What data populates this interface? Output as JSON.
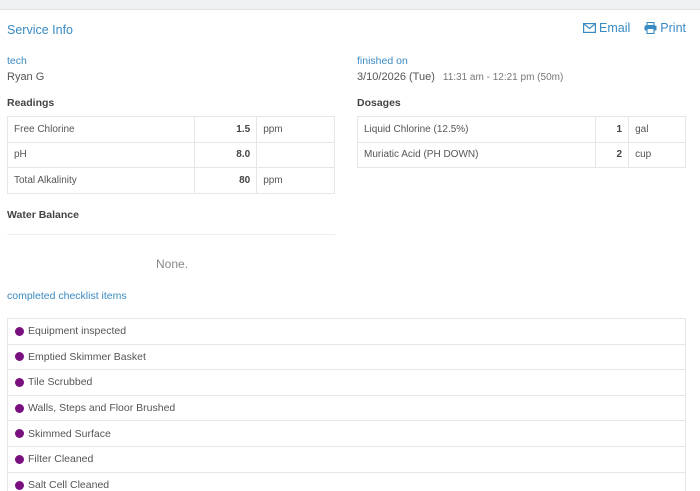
{
  "title": "Service Info",
  "actions": {
    "email": "Email",
    "print": "Print"
  },
  "tech": {
    "label": "tech",
    "value": "Ryan G"
  },
  "finished": {
    "label": "finished on",
    "date": "3/10/2026 (Tue)",
    "time": "11:31 am - 12:21 pm (50m)"
  },
  "readings": {
    "title": "Readings",
    "rows": [
      {
        "name": "Free Chlorine",
        "value": "1.5",
        "unit": "ppm"
      },
      {
        "name": "pH",
        "value": "8.0",
        "unit": ""
      },
      {
        "name": "Total Alkalinity",
        "value": "80",
        "unit": "ppm"
      }
    ]
  },
  "dosages": {
    "title": "Dosages",
    "rows": [
      {
        "name": "Liquid Chlorine (12.5%)",
        "value": "1",
        "unit": "gal"
      },
      {
        "name": "Muriatic Acid (PH DOWN)",
        "value": "2",
        "unit": "cup"
      }
    ]
  },
  "water_balance": {
    "title": "Water Balance",
    "empty": "None."
  },
  "checklist": {
    "title": "completed checklist items",
    "dot_color": "#7a1080",
    "items": [
      "Equipment inspected",
      "Emptied Skimmer Basket",
      "Tile Scrubbed",
      "Walls, Steps and Floor Brushed",
      "Skimmed Surface",
      "Filter Cleaned",
      "Salt Cell Cleaned"
    ]
  },
  "colors": {
    "accent": "#3a8ac2",
    "border": "#e4e6e9"
  }
}
